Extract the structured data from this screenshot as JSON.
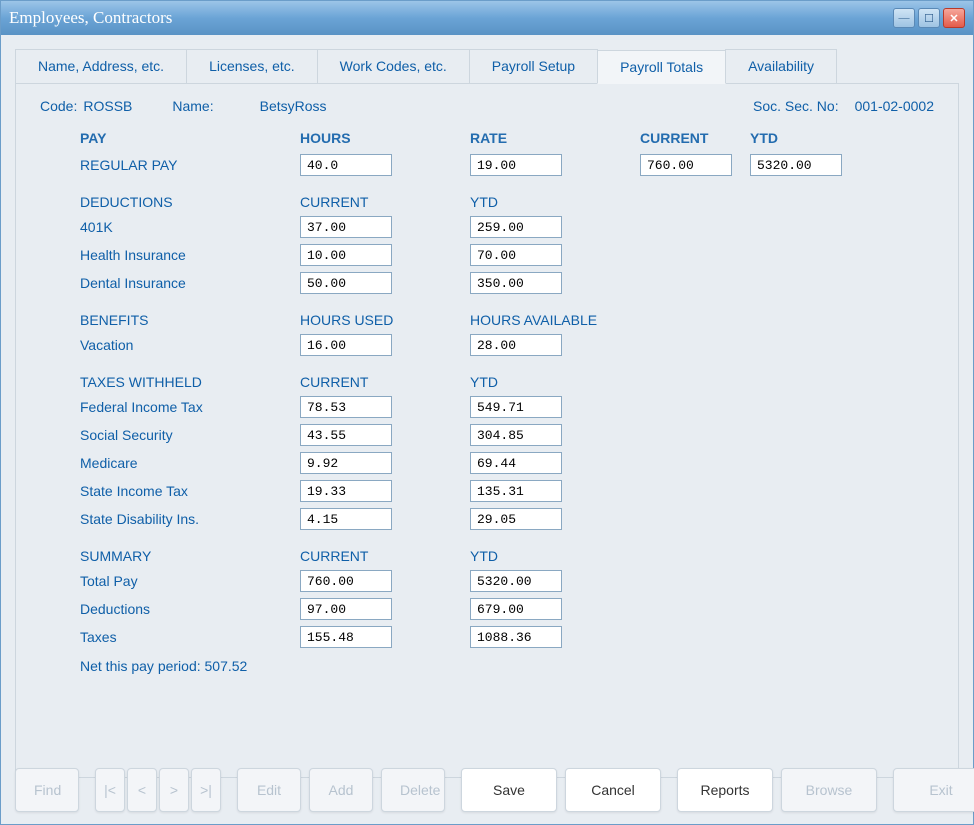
{
  "window": {
    "title": "Employees, Contractors"
  },
  "tabs": [
    {
      "label": "Name, Address, etc."
    },
    {
      "label": "Licenses, etc."
    },
    {
      "label": "Work Codes, etc."
    },
    {
      "label": "Payroll Setup"
    },
    {
      "label": "Payroll Totals"
    },
    {
      "label": "Availability"
    }
  ],
  "info": {
    "code_label": "Code:",
    "code": "ROSSB",
    "name_label": "Name:",
    "name": "BetsyRoss",
    "ssn_label": "Soc. Sec. No:",
    "ssn": "001-02-0002"
  },
  "headers": {
    "pay": "PAY",
    "hours": "HOURS",
    "rate": "RATE",
    "current": "CURRENT",
    "ytd": "YTD"
  },
  "pay": {
    "regular_label": "REGULAR PAY",
    "hours": "40.0",
    "rate": "19.00",
    "current": "760.00",
    "ytd": "5320.00"
  },
  "deductions": {
    "header": "DEDUCTIONS",
    "col1": "CURRENT",
    "col2": "YTD",
    "rows": [
      {
        "label": "401K",
        "current": "37.00",
        "ytd": "259.00"
      },
      {
        "label": "Health Insurance",
        "current": "10.00",
        "ytd": "70.00"
      },
      {
        "label": "Dental Insurance",
        "current": "50.00",
        "ytd": "350.00"
      }
    ]
  },
  "benefits": {
    "header": "BENEFITS",
    "col1": "HOURS USED",
    "col2": "HOURS AVAILABLE",
    "rows": [
      {
        "label": "Vacation",
        "used": "16.00",
        "avail": "28.00"
      }
    ]
  },
  "taxes": {
    "header": "TAXES WITHHELD",
    "col1": "CURRENT",
    "col2": "YTD",
    "rows": [
      {
        "label": "Federal Income Tax",
        "current": "78.53",
        "ytd": "549.71"
      },
      {
        "label": "Social Security",
        "current": "43.55",
        "ytd": "304.85"
      },
      {
        "label": "Medicare",
        "current": "9.92",
        "ytd": "69.44"
      },
      {
        "label": "State Income Tax",
        "current": "19.33",
        "ytd": "135.31"
      },
      {
        "label": "State Disability Ins.",
        "current": "4.15",
        "ytd": "29.05"
      }
    ]
  },
  "summary": {
    "header": "SUMMARY",
    "col1": "CURRENT",
    "col2": "YTD",
    "rows": [
      {
        "label": "Total Pay",
        "current": "760.00",
        "ytd": "5320.00"
      },
      {
        "label": "Deductions",
        "current": "97.00",
        "ytd": "679.00"
      },
      {
        "label": "Taxes",
        "current": "155.48",
        "ytd": "1088.36"
      }
    ],
    "net_label": "Net this pay period: 507.52"
  },
  "buttons": {
    "find": "Find",
    "first": "|<",
    "prev": "<",
    "next": ">",
    "last": ">|",
    "edit": "Edit",
    "add": "Add",
    "delete": "Delete",
    "save": "Save",
    "cancel": "Cancel",
    "reports": "Reports",
    "browse": "Browse",
    "exit": "Exit"
  }
}
